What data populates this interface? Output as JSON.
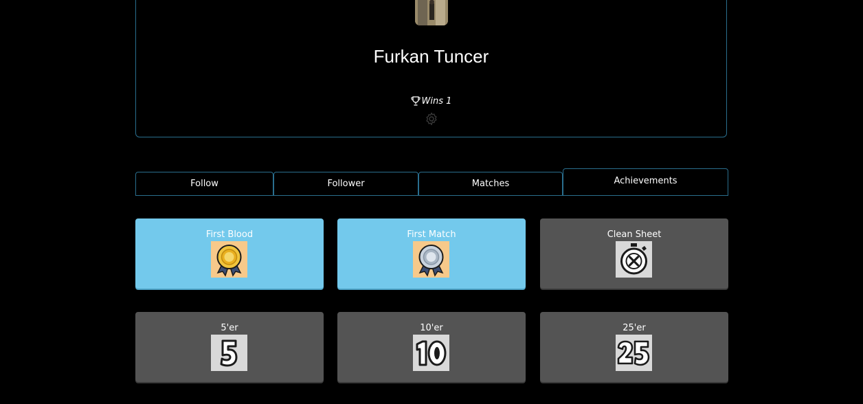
{
  "profile": {
    "name": "Furkan Tuncer",
    "wins_label": "Wins 1"
  },
  "tabs": [
    {
      "label": "Follow"
    },
    {
      "label": "Follower"
    },
    {
      "label": "Matches"
    },
    {
      "label": "Achievements"
    }
  ],
  "achievements": [
    {
      "title": "First Blood",
      "unlocked": true,
      "icon": "gold-medal-icon"
    },
    {
      "title": "First Match",
      "unlocked": true,
      "icon": "silver-medal-icon"
    },
    {
      "title": "Clean Sheet",
      "unlocked": false,
      "icon": "stopwatch-x-icon"
    },
    {
      "title": "5'er",
      "unlocked": false,
      "icon": "number-5-icon"
    },
    {
      "title": "10'er",
      "unlocked": false,
      "icon": "number-10-icon"
    },
    {
      "title": "25'er",
      "unlocked": false,
      "icon": "number-25-icon"
    }
  ],
  "colors": {
    "background": "#000000",
    "accent_border": "#2a6f8f",
    "unlocked": "#73c9ec",
    "locked": "#545454"
  }
}
